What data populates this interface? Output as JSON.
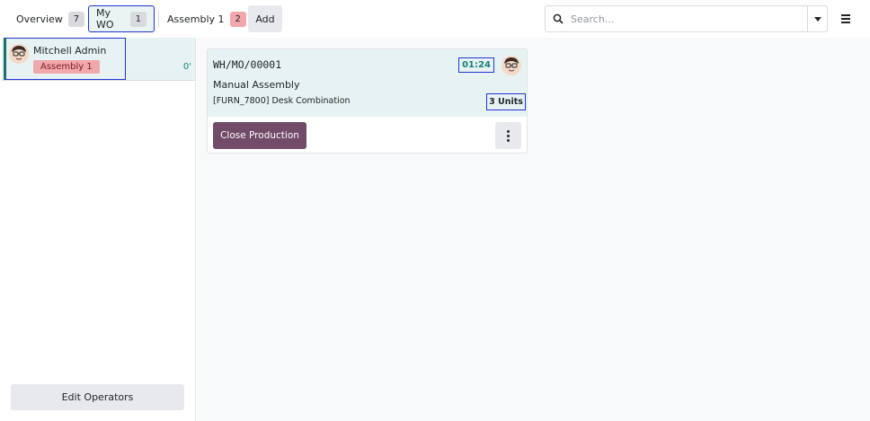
{
  "tabs": [
    {
      "label": "Overview",
      "count": "7"
    },
    {
      "label": "My WO",
      "count": "1"
    },
    {
      "label": "Assembly 1",
      "count": "2"
    }
  ],
  "add_label": "Add",
  "search": {
    "placeholder": "Search...",
    "value": ""
  },
  "icons": {
    "search": "magnifier-icon",
    "dropdown": "caret-down-icon",
    "menu": "hamburger-icon",
    "more": "vertical-dots-icon"
  },
  "sidebar": {
    "operator": {
      "name": "Mitchell Admin",
      "workcenter": "Assembly 1",
      "time": "0'"
    },
    "edit_label": "Edit Operators"
  },
  "workorder": {
    "name": "WH/MO/00001",
    "timer": "01:24",
    "operation": "Manual Assembly",
    "product": "[FURN_7800] Desk Combination",
    "quantity": "3 Units",
    "close_label": "Close Production"
  },
  "colors": {
    "accent": "#714b67",
    "highlight": "#1f34d4",
    "teal": "#16807c",
    "badge_red": "#f2a7ab"
  }
}
